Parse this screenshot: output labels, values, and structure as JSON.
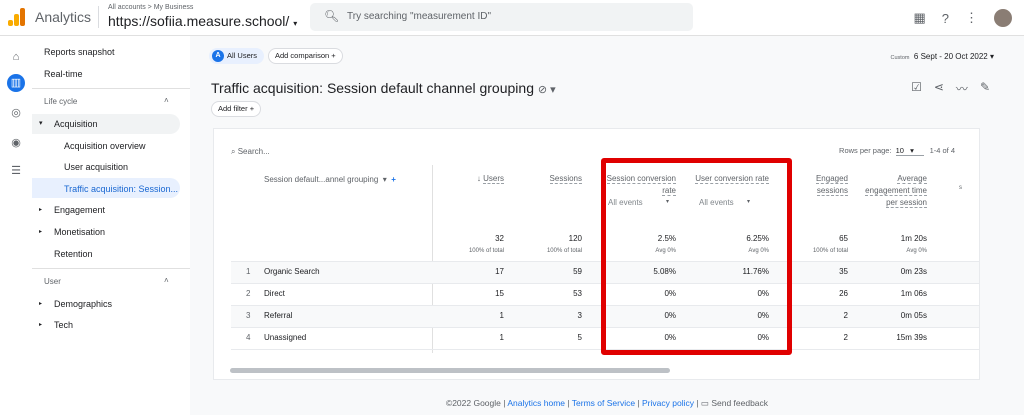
{
  "topbar": {
    "app": "Analytics",
    "breadcrumb": "All accounts > My Business",
    "property": "https://sofiia.measure.school/",
    "search_placeholder": "Try searching \"measurement ID\""
  },
  "sidebar": {
    "items": [
      {
        "label": "Reports snapshot"
      },
      {
        "label": "Real-time"
      },
      {
        "label": "Life cycle"
      },
      {
        "label": "Acquisition"
      },
      {
        "label": "Acquisition overview"
      },
      {
        "label": "User acquisition"
      },
      {
        "label": "Traffic acquisition: Session..."
      },
      {
        "label": "Engagement"
      },
      {
        "label": "Monetisation"
      },
      {
        "label": "Retention"
      },
      {
        "label": "User"
      },
      {
        "label": "Demographics"
      },
      {
        "label": "Tech"
      }
    ]
  },
  "main": {
    "segment_badge": "A",
    "segment": "All Users",
    "add_comparison": "Add comparison",
    "date_label": "Custom",
    "date_range": "6 Sept - 20 Oct 2022",
    "title": "Traffic acquisition: Session default channel grouping",
    "add_filter": "Add filter"
  },
  "table": {
    "search_placeholder": "Search...",
    "rows_per_page_label": "Rows per page:",
    "rows_per_page": "10",
    "pagination": "1-4 of 4",
    "dimension_header": "Session default...annel grouping",
    "headers": [
      "Users",
      "Sessions",
      "Session conversion rate",
      "User conversion rate",
      "Engaged sessions",
      "Average engagement time per session"
    ],
    "event_filter": "All events",
    "totals": [
      "32",
      "120",
      "2.5%",
      "6.25%",
      "65",
      "1m 20s"
    ],
    "totals_sub": [
      "100% of total",
      "100% of total",
      "Avg 0%",
      "Avg 0%",
      "100% of total",
      "Avg 0%"
    ],
    "rows": [
      {
        "rank": "1",
        "name": "Organic Search",
        "values": [
          "17",
          "59",
          "5.08%",
          "11.76%",
          "35",
          "0m 23s"
        ]
      },
      {
        "rank": "2",
        "name": "Direct",
        "values": [
          "15",
          "53",
          "0%",
          "0%",
          "26",
          "1m 06s"
        ]
      },
      {
        "rank": "3",
        "name": "Referral",
        "values": [
          "1",
          "3",
          "0%",
          "0%",
          "2",
          "0m 05s"
        ]
      },
      {
        "rank": "4",
        "name": "Unassigned",
        "values": [
          "1",
          "5",
          "0%",
          "0%",
          "2",
          "15m 39s"
        ]
      }
    ]
  },
  "highlight_color": "#e00000",
  "footer": {
    "copyright": "©2022 Google |",
    "home": "Analytics home",
    "terms": "Terms of Service",
    "privacy": "Privacy policy",
    "feedback": "Send feedback"
  }
}
